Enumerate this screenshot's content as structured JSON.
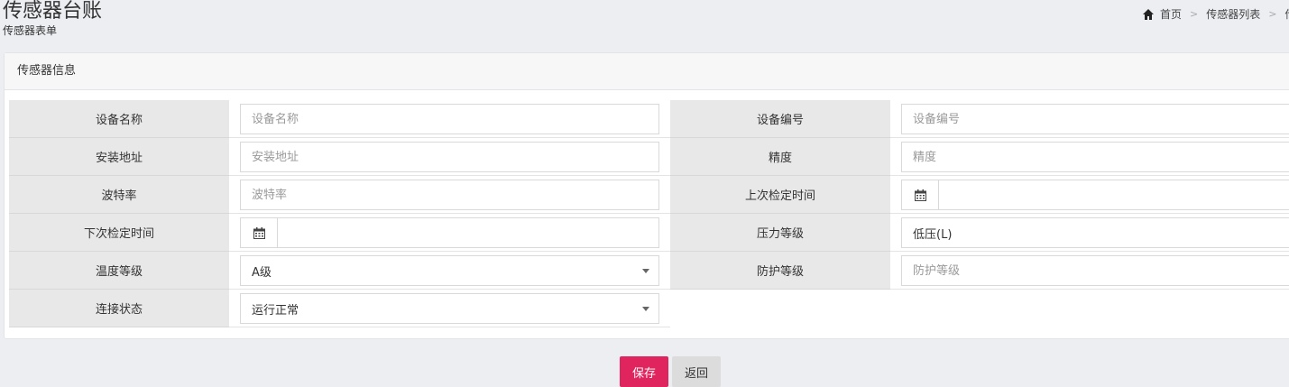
{
  "header": {
    "title": "传感器台账",
    "subtitle": "传感器表单"
  },
  "breadcrumb": {
    "home": "首页",
    "list": "传感器列表",
    "current": "传"
  },
  "panel": {
    "heading": "传感器信息"
  },
  "form": {
    "device_name_label": "设备名称",
    "device_name_placeholder": "设备名称",
    "device_code_label": "设备编号",
    "device_code_placeholder": "设备编号",
    "install_address_label": "安装地址",
    "install_address_placeholder": "安装地址",
    "precision_label": "精度",
    "precision_placeholder": "精度",
    "baud_rate_label": "波特率",
    "baud_rate_placeholder": "波特率",
    "last_check_label": "上次检定时间",
    "last_check_value": "",
    "next_check_label": "下次检定时间",
    "next_check_value": "",
    "pressure_level_label": "压力等级",
    "pressure_level_value": "低压(L)",
    "temp_level_label": "温度等级",
    "temp_level_value": "A级",
    "protection_level_label": "防护等级",
    "protection_level_placeholder": "防护等级",
    "connection_label": "连接状态",
    "connection_value": "运行正常"
  },
  "buttons": {
    "save": "保存",
    "back": "返回"
  },
  "colors": {
    "save_button": "#e0245e",
    "back_button": "#dcdcdc",
    "label_bg": "#e8e8e8"
  }
}
